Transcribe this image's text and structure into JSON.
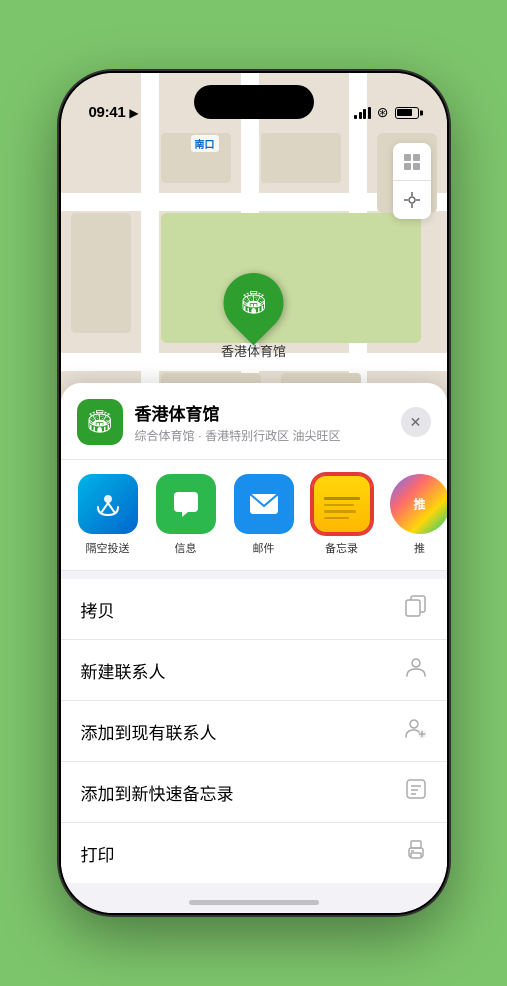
{
  "status_bar": {
    "time": "09:41",
    "location_icon": "▲"
  },
  "map": {
    "label": "南口",
    "pin_label": "香港体育馆",
    "controls": [
      "map-icon",
      "location-icon"
    ]
  },
  "place_card": {
    "name": "香港体育馆",
    "subtitle": "综合体育馆 · 香港特别行政区 油尖旺区",
    "close_label": "✕"
  },
  "share_actions": [
    {
      "id": "airdrop",
      "label": "隔空投送",
      "type": "airdrop"
    },
    {
      "id": "messages",
      "label": "信息",
      "type": "messages"
    },
    {
      "id": "mail",
      "label": "邮件",
      "type": "mail"
    },
    {
      "id": "notes",
      "label": "备忘录",
      "type": "notes"
    },
    {
      "id": "more",
      "label": "推",
      "type": "more"
    }
  ],
  "action_items": [
    {
      "label": "拷贝",
      "icon": "copy"
    },
    {
      "label": "新建联系人",
      "icon": "person"
    },
    {
      "label": "添加到现有联系人",
      "icon": "person-add"
    },
    {
      "label": "添加到新快速备忘录",
      "icon": "note"
    },
    {
      "label": "打印",
      "icon": "print"
    }
  ]
}
